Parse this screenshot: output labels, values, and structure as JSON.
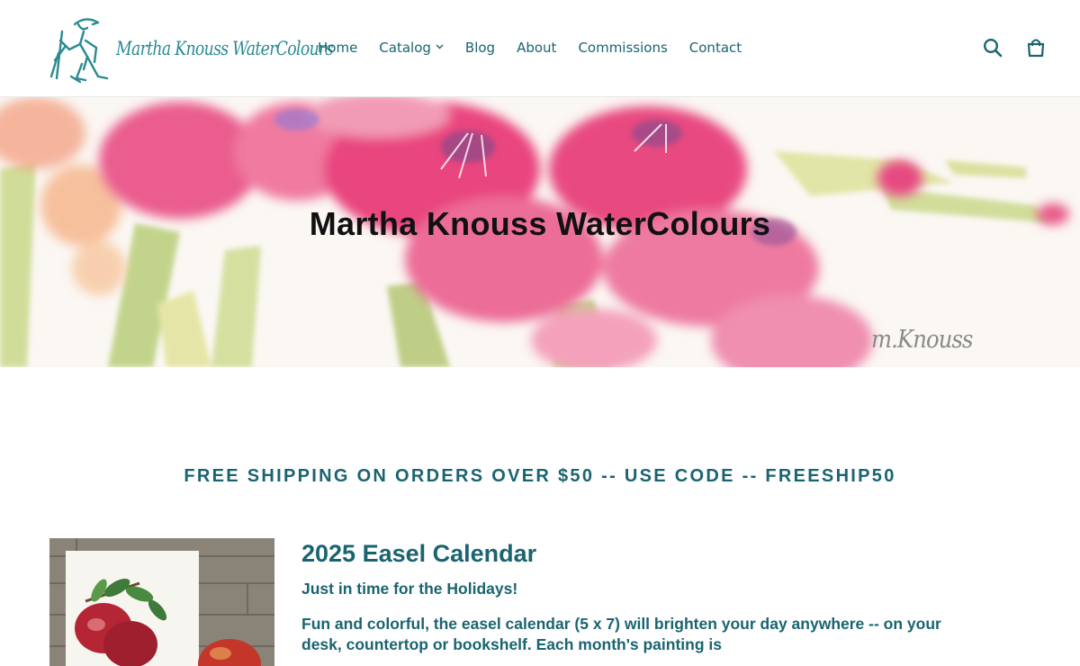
{
  "brand": {
    "logo_text": "Martha Knouss WaterColours"
  },
  "nav": {
    "items": [
      {
        "label": "Home"
      },
      {
        "label": "Catalog",
        "has_dropdown": true
      },
      {
        "label": "Blog"
      },
      {
        "label": "About"
      },
      {
        "label": "Commissions"
      },
      {
        "label": "Contact"
      }
    ]
  },
  "header_icons": {
    "search": "search-icon",
    "cart": "cart-icon"
  },
  "hero": {
    "title": "Martha Knouss WaterColours",
    "signature": "m.Knouss"
  },
  "promo": {
    "text": "FREE SHIPPING ON ORDERS OVER $50 -- USE CODE -- FREESHIP50"
  },
  "product": {
    "title": "2025 Easel Calendar",
    "subtitle": "Just in time for the Holidays!",
    "description": "Fun and colorful, the easel calendar (5 x 7) will brighten your day anywhere -- on your desk, countertop or bookshelf. Each month's painting is"
  },
  "colors": {
    "accent": "#1a6470",
    "logo": "#2a8a90",
    "hero_title": "#111111"
  }
}
